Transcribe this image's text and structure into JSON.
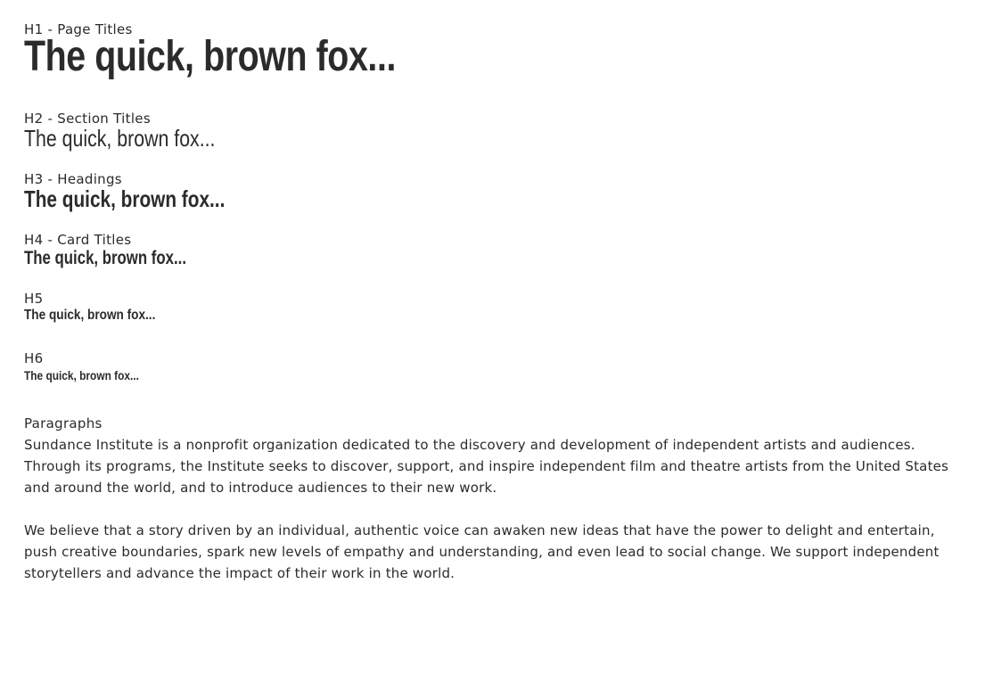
{
  "headings": [
    {
      "label": "H1 - Page Titles",
      "sample": "The quick, brown fox..."
    },
    {
      "label": "H2 - Section Titles",
      "sample": "The quick, brown fox..."
    },
    {
      "label": "H3 - Headings",
      "sample": "The quick, brown fox..."
    },
    {
      "label": "H4 - Card Titles",
      "sample": "The quick, brown fox..."
    },
    {
      "label": "H5",
      "sample": "The quick, brown fox..."
    },
    {
      "label": "H6",
      "sample": "The quick, brown fox..."
    }
  ],
  "paragraphs": {
    "label": "Paragraphs",
    "items": [
      "Sundance Institute is a nonprofit organization dedicated to the discovery and development of independent artists and audiences. Through its programs, the Institute seeks to discover, support, and inspire independent film and theatre artists from the United States and around the world, and to introduce audiences to their new work.",
      "We believe that a story driven by an individual, authentic voice can awaken new ideas that have the power to delight and entertain, push creative boundaries, spark new levels of empathy and understanding, and even lead to social change. We support independent storytellers and advance the impact of their work in the world."
    ]
  }
}
